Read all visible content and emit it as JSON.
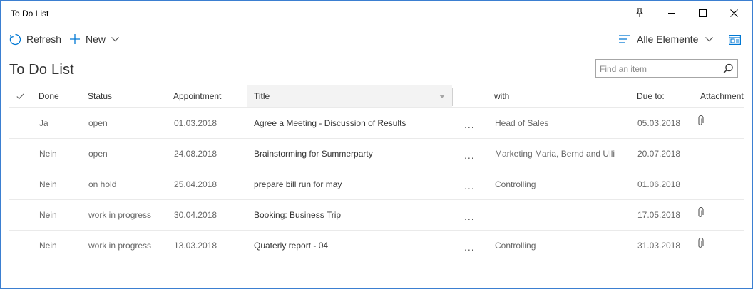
{
  "window": {
    "title": "To Do List"
  },
  "commands": {
    "refresh": "Refresh",
    "new": "New",
    "view": "Alle Elemente"
  },
  "page_title": "To Do List",
  "search": {
    "placeholder": "Find an item"
  },
  "columns": {
    "done": "Done",
    "status": "Status",
    "appointment": "Appointment",
    "title": "Title",
    "with": "with",
    "due": "Due to:",
    "attachments": "Attachments"
  },
  "rows": [
    {
      "done": "Ja",
      "status": "open",
      "appointment": "01.03.2018",
      "title": "Agree a Meeting - Discussion of Results",
      "more": "...",
      "with": "Head of Sales",
      "due": "05.03.2018",
      "attachment": true
    },
    {
      "done": "Nein",
      "status": "open",
      "appointment": "24.08.2018",
      "title": "Brainstorming for Summerparty",
      "more": "...",
      "with": "Marketing Maria, Bernd and Ulli",
      "due": "20.07.2018",
      "attachment": false
    },
    {
      "done": "Nein",
      "status": "on hold",
      "appointment": "25.04.2018",
      "title": "prepare bill run for may",
      "more": "...",
      "with": "Controlling",
      "due": "01.06.2018",
      "attachment": false
    },
    {
      "done": "Nein",
      "status": "work in progress",
      "appointment": "30.04.2018",
      "title": "Booking: Business Trip",
      "more": "...",
      "with": "",
      "due": "17.05.2018",
      "attachment": true
    },
    {
      "done": "Nein",
      "status": "work in progress",
      "appointment": "13.03.2018",
      "title": "Quaterly report - 04",
      "more": "...",
      "with": "Controlling",
      "due": "31.03.2018",
      "attachment": true
    }
  ],
  "colors": {
    "accent": "#0078d4",
    "border": "#3b7fd1",
    "header_active": "#f3f3f3"
  }
}
